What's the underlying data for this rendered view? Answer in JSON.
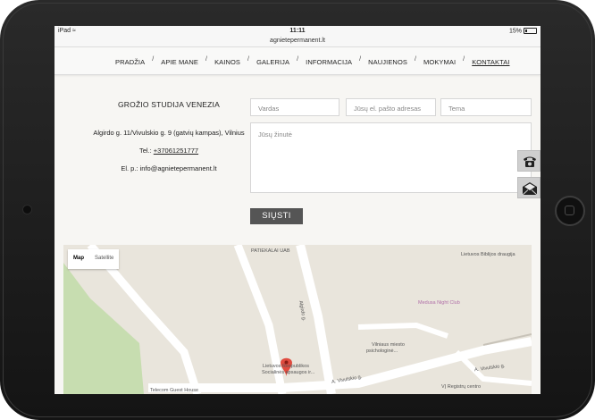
{
  "status_bar": {
    "carrier": "iPad",
    "time": "11:11",
    "battery": "15%"
  },
  "url": "agnietepermanent.lt",
  "nav": {
    "items": [
      {
        "label": "PRADŽIA"
      },
      {
        "label": "APIE MANE"
      },
      {
        "label": "KAINOS"
      },
      {
        "label": "GALERIJA"
      },
      {
        "label": "INFORMACIJA"
      },
      {
        "label": "NAUJIENOS"
      },
      {
        "label": "MOKYMAI"
      },
      {
        "label": "KONTAKTAI",
        "active": true
      }
    ],
    "separator": "/"
  },
  "contact": {
    "studio_name": "GROŽIO STUDIJA VENEZIA",
    "address": "Algirdo g. 11/Vivulskio g. 9 (gatvių kampas), Vilnius",
    "phone_label": "Tel.:",
    "phone": "+37061251777",
    "email_label": "El. p.:",
    "email": "info@agnietepermanent.lt"
  },
  "form": {
    "name_placeholder": "Vardas",
    "email_placeholder": "Jūsų el. pašto adresas",
    "subject_placeholder": "Tema",
    "message_placeholder": "Jūsų žinutė",
    "send_label": "SIŲSTI"
  },
  "side_buttons": {
    "phone_icon": "telephone-icon",
    "mail_icon": "envelope-icon"
  },
  "map": {
    "tabs": {
      "map": "Map",
      "satellite": "Satellite"
    },
    "labels": {
      "patiekalai": "PATIEKALAI UAB",
      "bibles": "Lietuvos Biblijos draugija",
      "algirdo": "Algirdo g.",
      "medusa": "Medusa Night Club",
      "psych1": "Vilniaus miesto",
      "psych2": "psichologinė...",
      "social1": "Lietuvos Respublikos",
      "social2": "Socialinės apsaugos ir...",
      "vivulskio1": "A. Vivulskio g.",
      "vivulskio2": "A. Vivulskio g.",
      "telecom": "Telecom Guest House",
      "registru": "VĮ Registrų centro"
    },
    "colors": {
      "park": "#c7ddb0",
      "road": "#ffffff",
      "land": "#e9e5dc",
      "marker": "#e04b3f"
    }
  }
}
